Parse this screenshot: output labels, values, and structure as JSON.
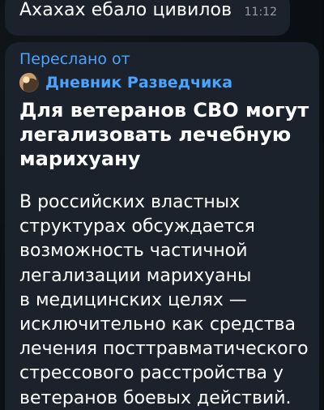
{
  "chat": {
    "top_message": {
      "text": "Ахахах ебало цивилов",
      "time": "11:12"
    },
    "forwarded_message": {
      "forwarded_label": "Переслано от",
      "channel_name": "Дневник Разведчика",
      "avatar_icon": "channel-avatar-icon",
      "title": "Для ветеранов СВО могут\nлегализовать лечебную\nмарихуану",
      "body": "В российских властных\nструктурах обсуждается\nвозможность частичной\nлегализации марихуаны\nв медицинских целях —\nисключительно как средства\nлечения посттравматического\nстрессового расстройства у\nветеранов боевых действий."
    }
  }
}
